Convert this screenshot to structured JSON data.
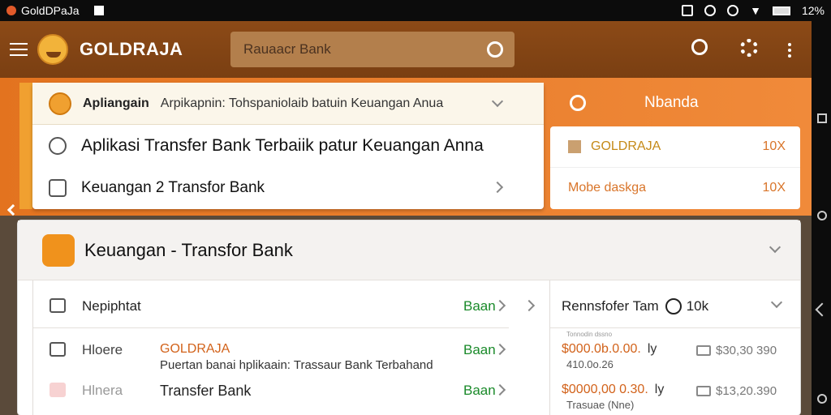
{
  "status_bar": {
    "app_name": "GoldDPaJa",
    "battery": "12%"
  },
  "app_bar": {
    "brand": "GOLDRAJA",
    "search_placeholder": "Rauaacr Bank"
  },
  "top_card": {
    "header_bold": "Apliangain",
    "header_text": "Arpikapnin: Tohspaniolaib batuin Keuangan Anua",
    "rows": [
      {
        "label": "Aplikasi Transfer Bank Terbaiik patur Keuangan Anna"
      },
      {
        "label": "Keuangan 2 Transfor Bank"
      }
    ]
  },
  "side_card": {
    "title": "Nbanda",
    "rows": [
      {
        "name": "GOLDRAJA",
        "value": "10X"
      },
      {
        "name": "Mobe daskga",
        "value": "10X"
      }
    ]
  },
  "main_card": {
    "title": "Keuangan - Transfor Bank",
    "list": [
      {
        "label": "Nepiphtat",
        "action": "Baan"
      },
      {
        "label": "Hloere",
        "title": "GOLDRAJA",
        "subtitle": "Puertan banai hplikaain: Trassaur Bank Terbahand",
        "action": "Baan"
      },
      {
        "label": "Hlnera",
        "title": "Transfer Bank",
        "action": "Baan"
      }
    ],
    "right": {
      "header": "Rennsfofer Tam",
      "header_badge": "10k",
      "tiny_caption": "Tonnodin dssno",
      "items": [
        {
          "amount": "$000.0b.0.00.",
          "suffix": "ly",
          "sub": "410.0o.26",
          "value": "$30,30 390"
        },
        {
          "amount": "$0000,00 0.30.",
          "suffix": "ly",
          "sub": "Trasuae (Nne)",
          "value": "$13,20.390"
        }
      ]
    }
  }
}
